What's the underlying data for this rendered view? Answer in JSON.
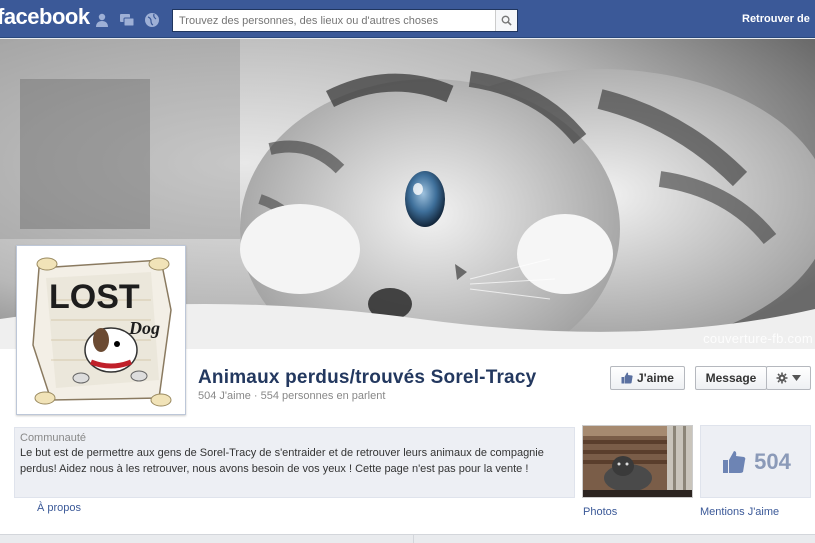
{
  "topbar": {
    "logo": "facebook",
    "search_placeholder": "Trouvez des personnes, des lieux ou d'autres choses",
    "find_friends": "Retrouver de"
  },
  "cover": {
    "watermark": "couverture-fb.com"
  },
  "profile_picture": {
    "logo_text_1": "LOST",
    "logo_text_2": "Dog"
  },
  "page": {
    "name": "Animaux perdus/trouvés Sorel-Tracy",
    "stats": "504 J'aime · 554 personnes en parlent",
    "like_label": "J'aime",
    "message_label": "Message"
  },
  "about": {
    "category": "Communauté",
    "text": "Le but est de permettre aux gens de Sorel-Tracy de s'entraider et de retrouver leurs animaux de compagnie perdus! Aidez nous à les retrouver, nous avons besoin de vos yeux ! Cette page n'est pas pour la vente !",
    "link": "À propos"
  },
  "apps": {
    "photos_label": "Photos",
    "likes_count": "504",
    "likes_label": "Mentions J'aime"
  },
  "colors": {
    "brand": "#3b5998",
    "title": "#23385f"
  }
}
